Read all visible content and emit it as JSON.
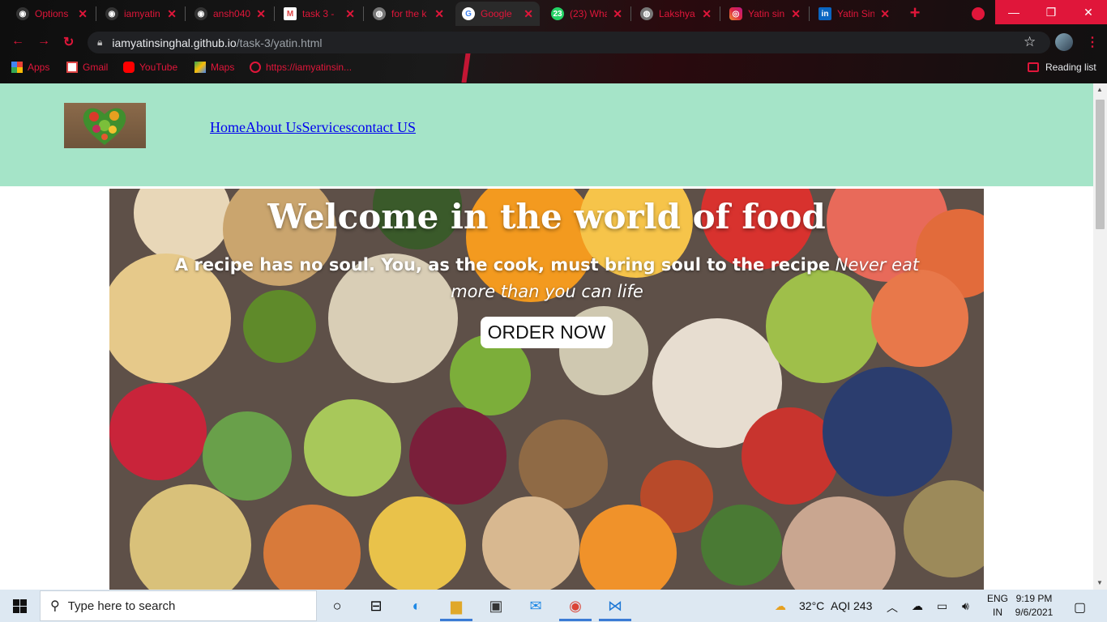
{
  "browser": {
    "tabs": [
      {
        "title": "Options",
        "favicon": "github-icon"
      },
      {
        "title": "iamyatin",
        "favicon": "github-icon"
      },
      {
        "title": "ansh040",
        "favicon": "github-icon"
      },
      {
        "title": "task 3 -",
        "favicon": "gmail-icon"
      },
      {
        "title": "for the k",
        "favicon": "globe-icon"
      },
      {
        "title": "Google",
        "favicon": "google-icon"
      },
      {
        "title": "(23) Wha",
        "favicon": "whatsapp-icon"
      },
      {
        "title": "Lakshya",
        "favicon": "globe-icon"
      },
      {
        "title": "Yatin sin",
        "favicon": "instagram-icon"
      },
      {
        "title": "Yatin Sin",
        "favicon": "linkedin-icon"
      }
    ],
    "url_host": "iamyatinsinghal.github.io",
    "url_path": "/task-3/yatin.html",
    "bookmarks": [
      {
        "label": "Apps",
        "icon": "apps-grid-icon"
      },
      {
        "label": "Gmail",
        "icon": "gmail-icon"
      },
      {
        "label": "YouTube",
        "icon": "youtube-icon"
      },
      {
        "label": "Maps",
        "icon": "maps-icon"
      },
      {
        "label": "https://iamyatinsin...",
        "icon": "globe-icon"
      }
    ],
    "reading_list": "Reading list",
    "accent_color": "#e0163a"
  },
  "site": {
    "header_bg": "#a5e4c8",
    "nav": [
      "Home",
      "About Us",
      "Services",
      "contact US"
    ],
    "hero": {
      "title": "Welcome in the world of food",
      "subtitle_bold": "A recipe has no soul. You, as the cook, must bring soul to the recipe",
      "subtitle_italic": " Never eat more than you can life",
      "button": "ORDER NOW"
    }
  },
  "taskbar": {
    "search_placeholder": "Type here to search",
    "weather": "32°C",
    "aqi": "AQI 243",
    "lang_top": "ENG",
    "lang_bottom": "IN",
    "time": "9:19 PM",
    "date": "9/6/2021"
  }
}
